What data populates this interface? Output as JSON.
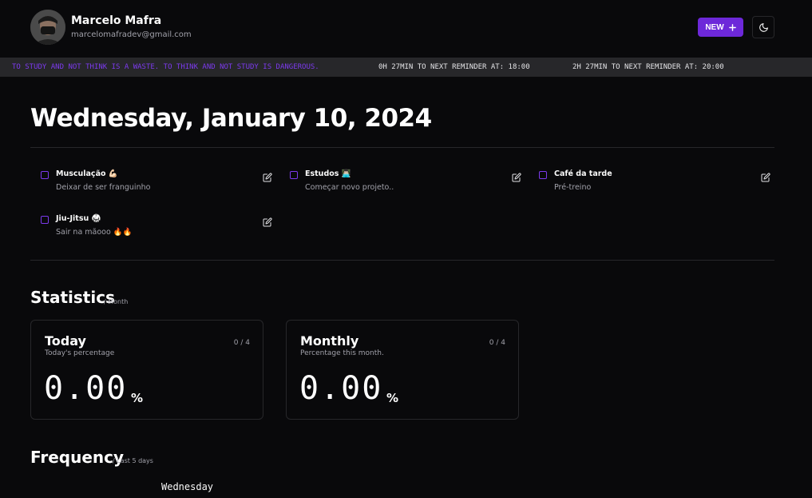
{
  "user": {
    "name": "Marcelo Mafra",
    "email": "marcelomafradev@gmail.com"
  },
  "header": {
    "new_label": "NEW"
  },
  "ticker": {
    "quote": "TO STUDY AND NOT THINK IS A WASTE. TO THINK AND NOT STUDY IS DANGEROUS.",
    "reminders": [
      "0H 27MIN TO NEXT REMINDER AT: 18:00",
      "2H 27MIN TO NEXT REMINDER AT: 20:00"
    ]
  },
  "date_title": "Wednesday, January 10, 2024",
  "tasks": [
    {
      "name": "Musculação 💪🏻",
      "desc": "Deixar de ser franguinho"
    },
    {
      "name": "Estudos 👨🏻‍💻",
      "desc": "Começar novo projeto.."
    },
    {
      "name": "Café da tarde",
      "desc": "Pré-treino"
    },
    {
      "name": "Jiu-Jitsu 🥋",
      "desc": "Sair na mãooo 🔥🔥"
    }
  ],
  "statistics": {
    "title": "Statistics",
    "subtitle": "/ Month",
    "cards": [
      {
        "title": "Today",
        "subtitle": "Today's percentage",
        "count": "0 / 4",
        "value": "0.00",
        "unit": "%"
      },
      {
        "title": "Monthly",
        "subtitle": "Percentage this month.",
        "count": "0 / 4",
        "value": "0.00",
        "unit": "%"
      }
    ]
  },
  "frequency": {
    "title": "Frequency",
    "subtitle": "/ Last 5 days",
    "day_label": "Wednesday"
  },
  "colors": {
    "accent": "#6d28d9",
    "ticker_quote": "#7c3aed",
    "background": "#09090b",
    "border": "#27272a"
  }
}
